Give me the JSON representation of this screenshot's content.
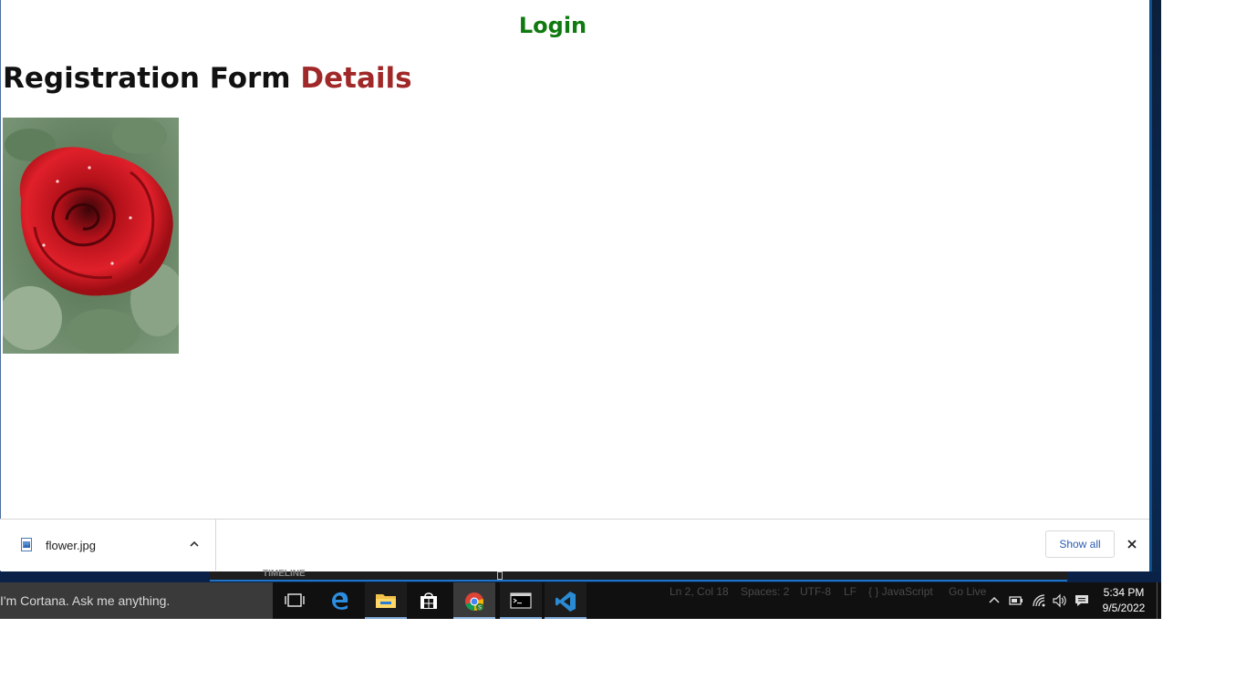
{
  "page": {
    "login_label": "Login",
    "heading_part1": "Registration Form",
    "heading_part2": "Details",
    "image_alt": "flower"
  },
  "downloads": {
    "file_name": "flower.jpg",
    "show_all_label": "Show all"
  },
  "vscode": {
    "timeline_label": "TIMELINE",
    "status": {
      "position": "Ln 2, Col 18",
      "spaces": "Spaces: 2",
      "encoding": "UTF-8",
      "eol": "LF",
      "language": "{ } JavaScript",
      "golive": "Go Live"
    }
  },
  "taskbar": {
    "cortana_text": "I'm Cortana. Ask me anything.",
    "apps": [
      "task-view",
      "edge",
      "file-explorer",
      "store",
      "chrome",
      "terminal",
      "vscode"
    ],
    "time": "5:34 PM",
    "date": "9/5/2022"
  },
  "colors": {
    "login": "#0f7a0f",
    "details": "#a02828",
    "link": "#2a5db0"
  }
}
